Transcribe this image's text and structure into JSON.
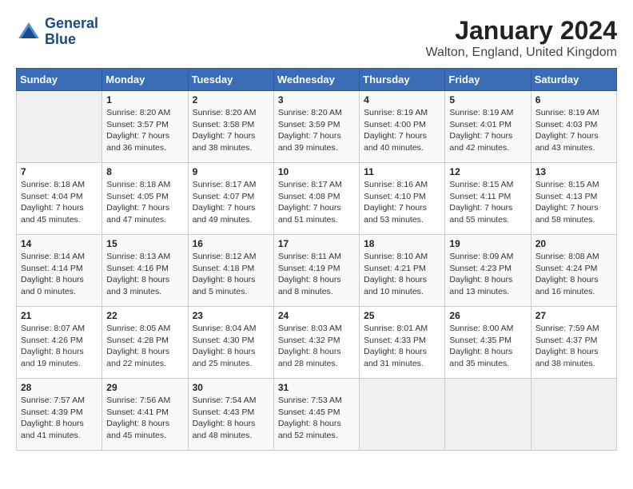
{
  "header": {
    "logo_line1": "General",
    "logo_line2": "Blue",
    "month": "January 2024",
    "location": "Walton, England, United Kingdom"
  },
  "days_of_week": [
    "Sunday",
    "Monday",
    "Tuesday",
    "Wednesday",
    "Thursday",
    "Friday",
    "Saturday"
  ],
  "weeks": [
    [
      {
        "day": "",
        "info": ""
      },
      {
        "day": "1",
        "info": "Sunrise: 8:20 AM\nSunset: 3:57 PM\nDaylight: 7 hours\nand 36 minutes."
      },
      {
        "day": "2",
        "info": "Sunrise: 8:20 AM\nSunset: 3:58 PM\nDaylight: 7 hours\nand 38 minutes."
      },
      {
        "day": "3",
        "info": "Sunrise: 8:20 AM\nSunset: 3:59 PM\nDaylight: 7 hours\nand 39 minutes."
      },
      {
        "day": "4",
        "info": "Sunrise: 8:19 AM\nSunset: 4:00 PM\nDaylight: 7 hours\nand 40 minutes."
      },
      {
        "day": "5",
        "info": "Sunrise: 8:19 AM\nSunset: 4:01 PM\nDaylight: 7 hours\nand 42 minutes."
      },
      {
        "day": "6",
        "info": "Sunrise: 8:19 AM\nSunset: 4:03 PM\nDaylight: 7 hours\nand 43 minutes."
      }
    ],
    [
      {
        "day": "7",
        "info": "Sunrise: 8:18 AM\nSunset: 4:04 PM\nDaylight: 7 hours\nand 45 minutes."
      },
      {
        "day": "8",
        "info": "Sunrise: 8:18 AM\nSunset: 4:05 PM\nDaylight: 7 hours\nand 47 minutes."
      },
      {
        "day": "9",
        "info": "Sunrise: 8:17 AM\nSunset: 4:07 PM\nDaylight: 7 hours\nand 49 minutes."
      },
      {
        "day": "10",
        "info": "Sunrise: 8:17 AM\nSunset: 4:08 PM\nDaylight: 7 hours\nand 51 minutes."
      },
      {
        "day": "11",
        "info": "Sunrise: 8:16 AM\nSunset: 4:10 PM\nDaylight: 7 hours\nand 53 minutes."
      },
      {
        "day": "12",
        "info": "Sunrise: 8:15 AM\nSunset: 4:11 PM\nDaylight: 7 hours\nand 55 minutes."
      },
      {
        "day": "13",
        "info": "Sunrise: 8:15 AM\nSunset: 4:13 PM\nDaylight: 7 hours\nand 58 minutes."
      }
    ],
    [
      {
        "day": "14",
        "info": "Sunrise: 8:14 AM\nSunset: 4:14 PM\nDaylight: 8 hours\nand 0 minutes."
      },
      {
        "day": "15",
        "info": "Sunrise: 8:13 AM\nSunset: 4:16 PM\nDaylight: 8 hours\nand 3 minutes."
      },
      {
        "day": "16",
        "info": "Sunrise: 8:12 AM\nSunset: 4:18 PM\nDaylight: 8 hours\nand 5 minutes."
      },
      {
        "day": "17",
        "info": "Sunrise: 8:11 AM\nSunset: 4:19 PM\nDaylight: 8 hours\nand 8 minutes."
      },
      {
        "day": "18",
        "info": "Sunrise: 8:10 AM\nSunset: 4:21 PM\nDaylight: 8 hours\nand 10 minutes."
      },
      {
        "day": "19",
        "info": "Sunrise: 8:09 AM\nSunset: 4:23 PM\nDaylight: 8 hours\nand 13 minutes."
      },
      {
        "day": "20",
        "info": "Sunrise: 8:08 AM\nSunset: 4:24 PM\nDaylight: 8 hours\nand 16 minutes."
      }
    ],
    [
      {
        "day": "21",
        "info": "Sunrise: 8:07 AM\nSunset: 4:26 PM\nDaylight: 8 hours\nand 19 minutes."
      },
      {
        "day": "22",
        "info": "Sunrise: 8:05 AM\nSunset: 4:28 PM\nDaylight: 8 hours\nand 22 minutes."
      },
      {
        "day": "23",
        "info": "Sunrise: 8:04 AM\nSunset: 4:30 PM\nDaylight: 8 hours\nand 25 minutes."
      },
      {
        "day": "24",
        "info": "Sunrise: 8:03 AM\nSunset: 4:32 PM\nDaylight: 8 hours\nand 28 minutes."
      },
      {
        "day": "25",
        "info": "Sunrise: 8:01 AM\nSunset: 4:33 PM\nDaylight: 8 hours\nand 31 minutes."
      },
      {
        "day": "26",
        "info": "Sunrise: 8:00 AM\nSunset: 4:35 PM\nDaylight: 8 hours\nand 35 minutes."
      },
      {
        "day": "27",
        "info": "Sunrise: 7:59 AM\nSunset: 4:37 PM\nDaylight: 8 hours\nand 38 minutes."
      }
    ],
    [
      {
        "day": "28",
        "info": "Sunrise: 7:57 AM\nSunset: 4:39 PM\nDaylight: 8 hours\nand 41 minutes."
      },
      {
        "day": "29",
        "info": "Sunrise: 7:56 AM\nSunset: 4:41 PM\nDaylight: 8 hours\nand 45 minutes."
      },
      {
        "day": "30",
        "info": "Sunrise: 7:54 AM\nSunset: 4:43 PM\nDaylight: 8 hours\nand 48 minutes."
      },
      {
        "day": "31",
        "info": "Sunrise: 7:53 AM\nSunset: 4:45 PM\nDaylight: 8 hours\nand 52 minutes."
      },
      {
        "day": "",
        "info": ""
      },
      {
        "day": "",
        "info": ""
      },
      {
        "day": "",
        "info": ""
      }
    ]
  ]
}
